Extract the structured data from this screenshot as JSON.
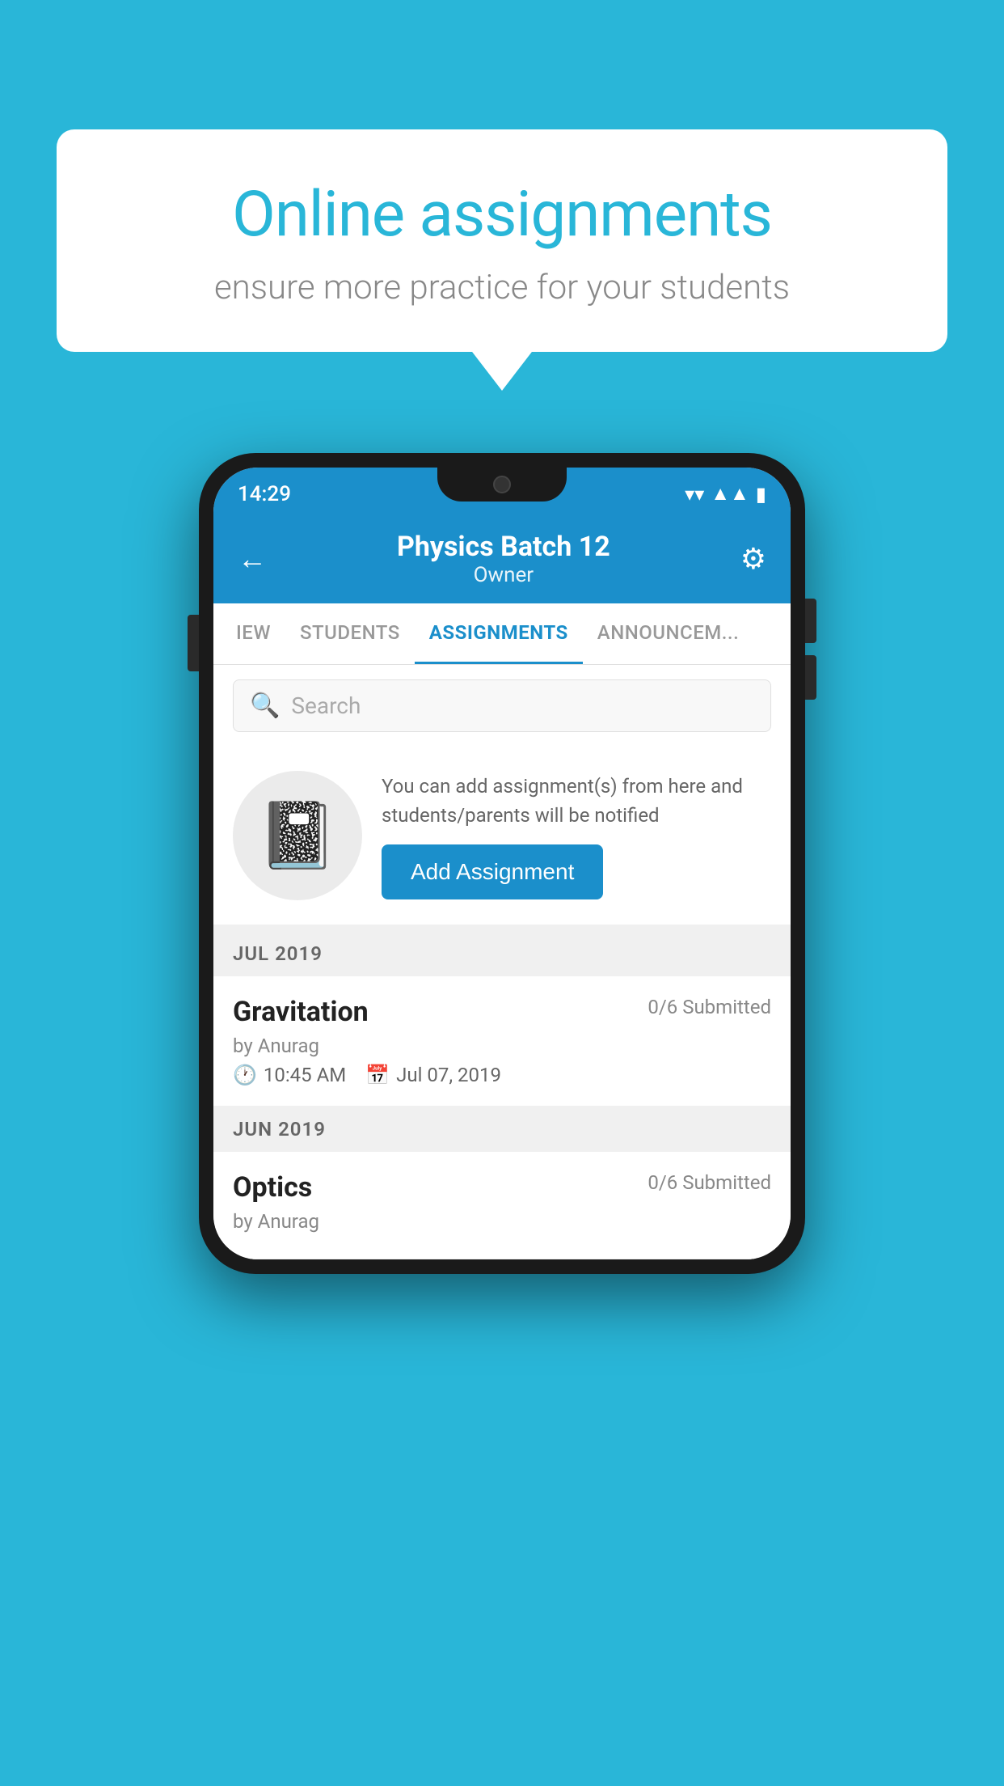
{
  "background_color": "#29b6d8",
  "speech_bubble": {
    "title": "Online assignments",
    "subtitle": "ensure more practice for your students"
  },
  "phone": {
    "status_bar": {
      "time": "14:29",
      "wifi": "▼",
      "signal": "▲",
      "battery": "▮"
    },
    "header": {
      "back_label": "←",
      "title": "Physics Batch 12",
      "subtitle": "Owner",
      "gear_label": "⚙"
    },
    "tabs": [
      {
        "label": "IEW",
        "active": false
      },
      {
        "label": "STUDENTS",
        "active": false
      },
      {
        "label": "ASSIGNMENTS",
        "active": true
      },
      {
        "label": "ANNOUNCEM...",
        "active": false
      }
    ],
    "search": {
      "placeholder": "Search"
    },
    "promo": {
      "icon": "📓",
      "description": "You can add assignment(s) from here and students/parents will be notified",
      "button_label": "Add Assignment"
    },
    "sections": [
      {
        "header": "JUL 2019",
        "assignments": [
          {
            "title": "Gravitation",
            "submitted": "0/6 Submitted",
            "by": "by Anurag",
            "time": "10:45 AM",
            "date": "Jul 07, 2019"
          }
        ]
      },
      {
        "header": "JUN 2019",
        "assignments": [
          {
            "title": "Optics",
            "submitted": "0/6 Submitted",
            "by": "by Anurag",
            "time": "",
            "date": ""
          }
        ]
      }
    ]
  }
}
